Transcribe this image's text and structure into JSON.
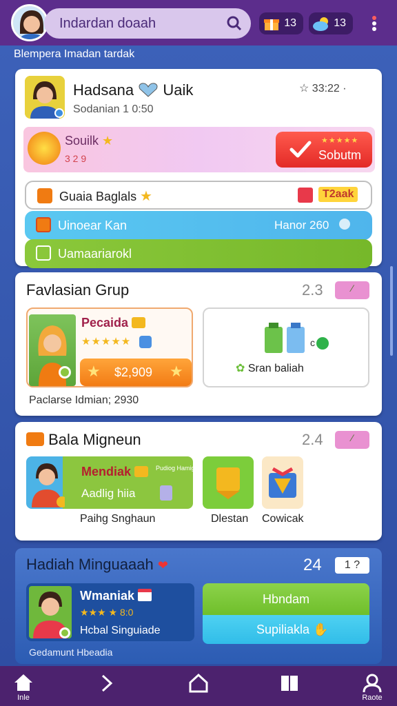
{
  "header": {
    "search_text": "Indardan doaah",
    "badge1_count": "13",
    "badge2_count": "13"
  },
  "subtitle": "Blempera Imadan tardak",
  "profile": {
    "name": "Hadsana",
    "name_suffix": "Uaik",
    "time": "Sodanian 1 0:50",
    "rating": "☆ 33:22 ·"
  },
  "promo": {
    "title": "Souilk",
    "subtitle": "3 2 9",
    "button_label": "Sobutm",
    "button_stars": "★★★★★"
  },
  "rows": [
    {
      "label": "Guaia Baglals",
      "right": "T2aak"
    },
    {
      "label": "Uinoear Kan",
      "right": "Hanor 260"
    },
    {
      "label": "Uamaariarokl",
      "right": ""
    }
  ],
  "section1": {
    "title": "Favlasian Grup",
    "count": "2.3",
    "tile1_title": "Pecaida",
    "tile1_stars": "★★★★★",
    "tile1_price": "$2,909",
    "tile2_label": "Sran baliah",
    "note": "Paclarse Idmian; 2930"
  },
  "section2": {
    "title": "Bala Migneun",
    "count": "2.4",
    "tile1_title": "Mendiak",
    "tile1_small": "Pudiog Hamigs",
    "tile1_sub": "Aadlig hiia",
    "tile1_caption": "Paihg Snghaun",
    "tile2_caption": "Dlestan",
    "tile3_caption": "Cowicak"
  },
  "section3": {
    "title": "Hadiah Minguaaah",
    "count": "24",
    "chip": "1 ?",
    "user_title": "Wmaniak",
    "user_stars": "★★★ ★ 8:0",
    "user_sub": "Hcbal Singuiade",
    "green_btn": "Hbndam",
    "blue_btn": "Supiliakla",
    "note": "Gedamunt Hbeadia"
  },
  "nav": [
    {
      "label": "Inle"
    },
    {
      "label": ""
    },
    {
      "label": ""
    },
    {
      "label": ""
    },
    {
      "label": "Raote"
    }
  ],
  "colors": {
    "purple": "#5c2d8c",
    "blue": "#3c61b9",
    "red": "#e32a27",
    "orange": "#f27b14",
    "green": "#76b82a",
    "lightblue": "#4fb5ec"
  }
}
